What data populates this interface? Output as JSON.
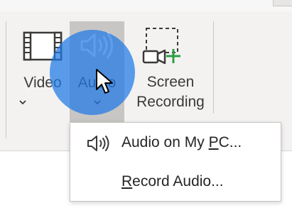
{
  "ribbon": {
    "buttons": {
      "video": {
        "label": "Video",
        "icon": "film-strip-icon"
      },
      "audio": {
        "label": "Audio",
        "icon": "speaker-icon"
      },
      "screen_recording": {
        "label_line1": "Screen",
        "label_line2": "Recording",
        "icon": "screen-recording-icon"
      }
    }
  },
  "audio_menu": {
    "items": [
      {
        "label_pre": "Audio on My ",
        "mnemonic": "P",
        "label_post": "C...",
        "icon": "speaker-icon"
      },
      {
        "label_pre": "",
        "mnemonic": "R",
        "label_post": "ecord Audio...",
        "icon": ""
      }
    ]
  },
  "colors": {
    "ribbon_bg": "#f3f2f1",
    "audio_pressed_bg": "#c8c6c4",
    "click_highlight": "#1e78e6",
    "plus_green": "#2e9e44"
  }
}
